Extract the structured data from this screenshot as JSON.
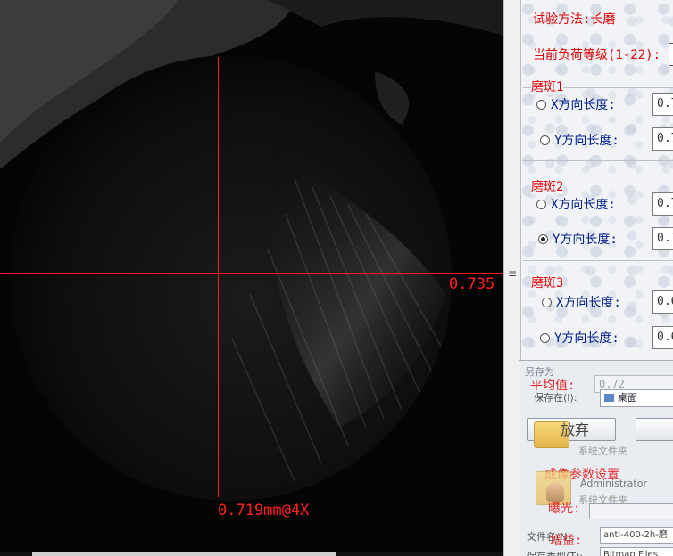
{
  "viewport": {
    "measure_y": "0.735",
    "measure_x": "0.719mm@4X"
  },
  "panel": {
    "test_method": "试验方法:长磨",
    "load_level_label": "当前负荷等级(1-22):",
    "spots": [
      {
        "title": "磨斑1",
        "x_label": "X方向长度:",
        "y_label": "Y方向长度:",
        "x_value": "0.7",
        "y_value": "0.7",
        "selected": "x"
      },
      {
        "title": "磨斑2",
        "x_label": "X方向长度:",
        "y_label": "Y方向长度:",
        "x_value": "0.7",
        "y_value": "0.7",
        "selected": "y"
      },
      {
        "title": "磨斑3",
        "x_label": "X方向长度:",
        "y_label": "Y方向长度:",
        "x_value": "0.6",
        "y_value": "0.6",
        "selected": "none"
      }
    ],
    "average_label": "平均值:",
    "average_value": "0.72",
    "abandon_label": "放弃",
    "imaging_params_label": "成像参数设置",
    "exposure_label": "曝光:",
    "gain_label": "增益:"
  },
  "dialog": {
    "title": "另存为",
    "save_in_label": "保存在(I):",
    "location": "桌面",
    "system_folder_1": "系统文件夹",
    "user_name": "Administrator",
    "system_folder_2": "系统文件夹",
    "filename_label": "文件名(N):",
    "filename_value": "anti-400-2h-磨",
    "filetype_label": "保存类型(T):",
    "filetype_value": "Bitmap Files"
  },
  "colors": {
    "crosshair": "#ff1a1a",
    "label_red": "#e00000",
    "label_blue": "#00208a"
  }
}
